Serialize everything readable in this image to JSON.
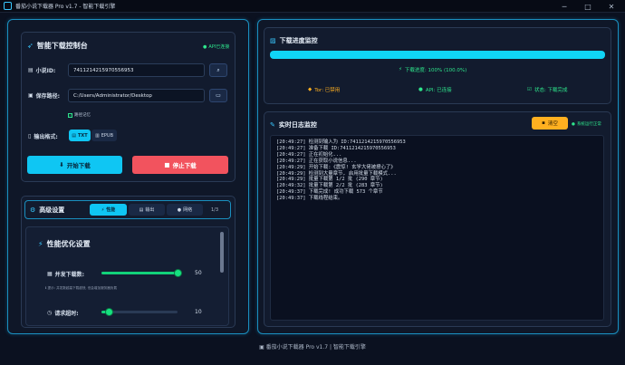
{
  "window": {
    "title": "番茄小说下载器 Pro v1.7 - 智能下载引擎",
    "minimize": "─",
    "maximize": "□",
    "close": "✕"
  },
  "control": {
    "title": "智能下载控制台",
    "api_status": "API已连接",
    "novel_id_label": "小说ID:",
    "novel_id_value": "7411214215970556953",
    "save_path_label": "保存路径:",
    "save_path_value": "C:/Users/Administrator/Desktop",
    "remember_label": "路径记忆",
    "format_label": "输出格式:",
    "format_txt": "TXT",
    "format_epub": "EPUB",
    "start_button": "开始下载",
    "stop_button": "停止下载"
  },
  "advanced": {
    "title": "高级设置",
    "tabs": [
      "性能",
      "输出",
      "网络"
    ],
    "page_indicator": "1/3",
    "perf_title": "性能优化设置",
    "concurrency_label": "并发下载数:",
    "concurrency_value": "50",
    "concurrency_hint": "提示: 并发数越高下载越快, 但会增加服务器负载",
    "timeout_label": "请求超时:",
    "timeout_value": "10"
  },
  "progress": {
    "title": "下载进度监控",
    "percent": 100,
    "text": "下载进度: 100% (100.0%)",
    "tor_label": "Tor: 已禁用",
    "api_label": "API: 已连接",
    "status_label": "状态: 下载完成"
  },
  "log": {
    "title": "实时日志监控",
    "clear_button": "清空",
    "system_status": "系统运行正常",
    "lines": [
      "[20:49:27] 检测到输入为 ID:7411214215970556953",
      "[20:49:27] 准备下载 ID:7411214215970556953",
      "[20:49:27] 正在初始化...",
      "[20:49:27] 正在获取小说信息...",
      "[20:49:29] 开始下载:《震惊! 玄学大佬被撩心了》",
      "[20:49:29] 检测到大量章节, 启用批量下载模式...",
      "[20:49:29] 批量下载第 1/2 批 (290 章节)",
      "[20:49:32] 批量下载第 2/2 批 (283 章节)",
      "[20:49:37] 下载完成! 成功下载 573 个章节",
      "[20:49:37] 下载线程结束。"
    ]
  },
  "footer": {
    "text": "番茄小说下载器 Pro v1.7 | 智能下载引擎"
  },
  "colors": {
    "accent": "#0fc6f3",
    "danger": "#f2535e",
    "success": "#2ee58c",
    "warning": "#ffb020"
  }
}
